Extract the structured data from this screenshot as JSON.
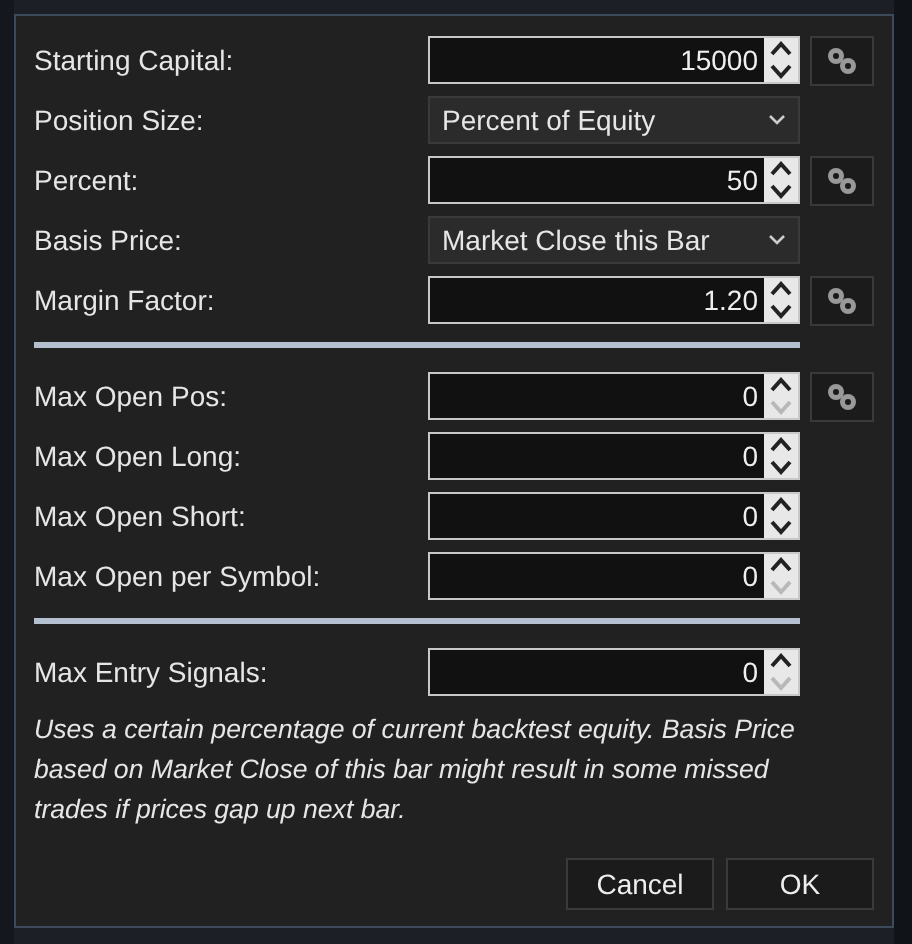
{
  "groups": [
    {
      "rows": [
        {
          "kind": "spin",
          "label": "Starting Capital:",
          "value": "15000",
          "down_disabled": false,
          "settings_button": true
        },
        {
          "kind": "select",
          "label": "Position Size:",
          "value": "Percent of Equity",
          "settings_button": false
        },
        {
          "kind": "spin",
          "label": "Percent:",
          "value": "50",
          "down_disabled": false,
          "settings_button": true
        },
        {
          "kind": "select",
          "label": "Basis Price:",
          "value": "Market Close this Bar",
          "settings_button": false
        },
        {
          "kind": "spin",
          "label": "Margin Factor:",
          "value": "1.20",
          "down_disabled": false,
          "settings_button": true
        }
      ]
    },
    {
      "rows": [
        {
          "kind": "spin",
          "label": "Max Open Pos:",
          "value": "0",
          "down_disabled": true,
          "settings_button": true
        },
        {
          "kind": "spin",
          "label": "Max Open Long:",
          "value": "0",
          "down_disabled": false,
          "settings_button": false
        },
        {
          "kind": "spin",
          "label": "Max Open Short:",
          "value": "0",
          "down_disabled": false,
          "settings_button": false
        },
        {
          "kind": "spin",
          "label": "Max Open per Symbol:",
          "value": "0",
          "down_disabled": true,
          "settings_button": false
        }
      ]
    },
    {
      "rows": [
        {
          "kind": "spin",
          "label": "Max Entry Signals:",
          "value": "0",
          "down_disabled": true,
          "settings_button": false
        }
      ]
    }
  ],
  "description": "Uses a certain percentage of current backtest equity. Basis Price based on Market Close of this bar might result in some missed trades if prices gap up next bar.",
  "buttons": [
    "Cancel",
    "OK"
  ]
}
